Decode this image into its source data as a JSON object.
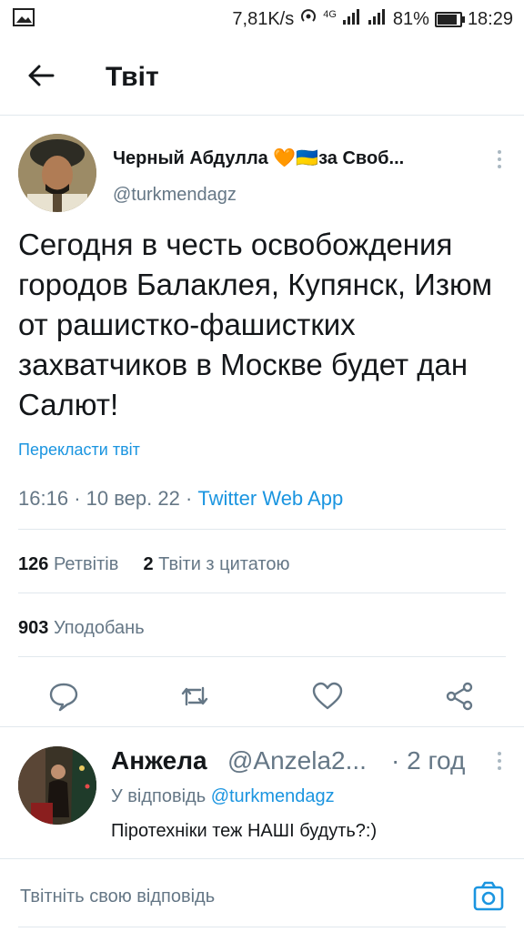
{
  "status_bar": {
    "speed": "7,81K/s",
    "network_type": "4G",
    "battery": "81%",
    "time": "18:29",
    "icons": [
      "image-icon",
      "hotspot-icon",
      "signal-icon",
      "signal-icon",
      "battery-icon"
    ]
  },
  "header": {
    "title": "Твіт",
    "back_icon": "arrow-left-icon"
  },
  "tweet": {
    "author_name": "Черный Абдулла 🧡🇺🇦за Своб...",
    "author_handle": "@turkmendagz",
    "text": "Сегодня в честь освобождения городов Балаклея, Купянск, Изюм от рашистко-фашистких захватчиков в Москве будет дан Салют!",
    "translate_label": "Перекласти твіт",
    "time": "16:16",
    "date": "10 вер. 22",
    "source_app": "Twitter Web App",
    "retweets_count": "126",
    "retweets_label": "Ретвітів",
    "quotes_count": "2",
    "quotes_label": "Твіти з цитатою",
    "likes_count": "903",
    "likes_label": "Уподобань",
    "action_icons": [
      "reply-icon",
      "retweet-icon",
      "like-icon",
      "share-icon"
    ]
  },
  "reply": {
    "author_name": "Анжела",
    "author_handle": "@Anzela2...",
    "time": "· 2 год",
    "replying_prefix": "У відповідь",
    "replying_to": "@turkmendagz",
    "text": "Піротехніки теж НАШІ будуть?:)"
  },
  "composer": {
    "placeholder": "Твітніть свою відповідь",
    "camera_icon": "camera-icon"
  },
  "colors": {
    "accent": "#1b95e0",
    "secondary_text": "#657786",
    "divider": "#e1e8ed"
  }
}
